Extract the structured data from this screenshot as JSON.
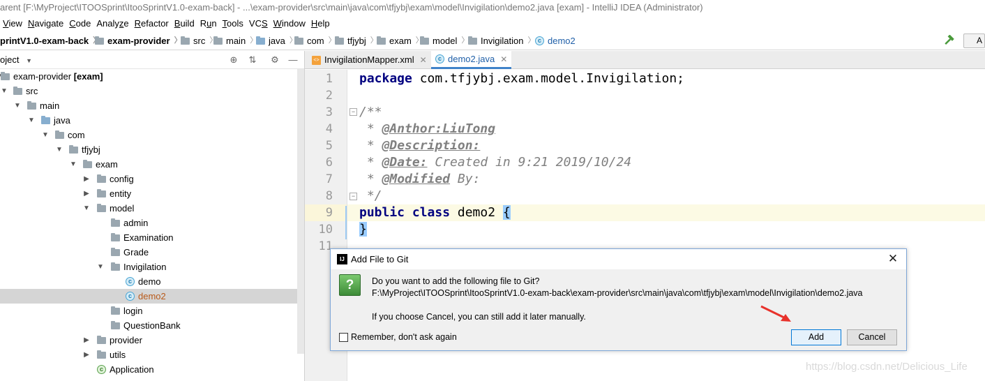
{
  "window": {
    "title": "arent [F:\\MyProject\\ITOOSprint\\ItooSprintV1.0-exam-back] - ...\\exam-provider\\src\\main\\java\\com\\tfjybj\\exam\\model\\Invigilation\\demo2.java [exam] - IntelliJ IDEA (Administrator)"
  },
  "menu": {
    "items": [
      {
        "label": "View",
        "mnemonic": "V"
      },
      {
        "label": "Navigate",
        "mnemonic": "N"
      },
      {
        "label": "Code",
        "mnemonic": "C"
      },
      {
        "label": "Analyze",
        "mnemonic": "z"
      },
      {
        "label": "Refactor",
        "mnemonic": "R"
      },
      {
        "label": "Build",
        "mnemonic": "B"
      },
      {
        "label": "Run",
        "mnemonic": "u"
      },
      {
        "label": "Tools",
        "mnemonic": "T"
      },
      {
        "label": "VCS",
        "mnemonic": "S"
      },
      {
        "label": "Window",
        "mnemonic": "W"
      },
      {
        "label": "Help",
        "mnemonic": "H"
      }
    ]
  },
  "breadcrumbs": [
    {
      "label": "printV1.0-exam-back",
      "icon": "none",
      "bold": true
    },
    {
      "label": "exam-provider",
      "icon": "module-folder-icon",
      "bold": true
    },
    {
      "label": "src",
      "icon": "folder-icon"
    },
    {
      "label": "main",
      "icon": "folder-icon"
    },
    {
      "label": "java",
      "icon": "source-folder-icon"
    },
    {
      "label": "com",
      "icon": "package-icon"
    },
    {
      "label": "tfjybj",
      "icon": "package-icon"
    },
    {
      "label": "exam",
      "icon": "package-icon"
    },
    {
      "label": "model",
      "icon": "package-icon"
    },
    {
      "label": "Invigilation",
      "icon": "package-icon"
    },
    {
      "label": "demo2",
      "icon": "class-icon"
    }
  ],
  "toolbar_right": {
    "label": "A"
  },
  "project_panel": {
    "title": "oject",
    "tree": [
      {
        "label": "exam-provider",
        "suffix": "[exam]",
        "arrow": "down",
        "icon": "module"
      },
      {
        "label": "src",
        "arrow": "down",
        "icon": "folder"
      },
      {
        "label": "main",
        "arrow": "down",
        "icon": "folder"
      },
      {
        "label": "java",
        "arrow": "down",
        "icon": "source"
      },
      {
        "label": "com",
        "arrow": "down",
        "icon": "package"
      },
      {
        "label": "tfjybj",
        "arrow": "down",
        "icon": "package"
      },
      {
        "label": "exam",
        "arrow": "down",
        "icon": "package"
      },
      {
        "label": "config",
        "arrow": "right",
        "icon": "package"
      },
      {
        "label": "entity",
        "arrow": "right",
        "icon": "package"
      },
      {
        "label": "model",
        "arrow": "down",
        "icon": "package"
      },
      {
        "label": "admin",
        "arrow": "none",
        "icon": "package"
      },
      {
        "label": "Examination",
        "arrow": "none",
        "icon": "package"
      },
      {
        "label": "Grade",
        "arrow": "none",
        "icon": "package"
      },
      {
        "label": "Invigilation",
        "arrow": "down",
        "icon": "package"
      },
      {
        "label": "demo",
        "arrow": "none",
        "icon": "class"
      },
      {
        "label": "demo2",
        "arrow": "none",
        "icon": "class",
        "selected": true
      },
      {
        "label": "login",
        "arrow": "none",
        "icon": "package"
      },
      {
        "label": "QuestionBank",
        "arrow": "none",
        "icon": "package"
      },
      {
        "label": "provider",
        "arrow": "right",
        "icon": "package"
      },
      {
        "label": "utils",
        "arrow": "right",
        "icon": "package"
      },
      {
        "label": "Application",
        "arrow": "none",
        "icon": "spring-class"
      }
    ]
  },
  "editor": {
    "tabs": [
      {
        "label": "InvigilationMapper.xml",
        "icon": "xml",
        "active": false
      },
      {
        "label": "demo2.java",
        "icon": "class",
        "active": true
      }
    ],
    "line_numbers": [
      "1",
      "2",
      "3",
      "4",
      "5",
      "6",
      "7",
      "8",
      "9",
      "10",
      "11"
    ],
    "lines": {
      "l1_kw": "package",
      "l1_rest": " com.tfjybj.exam.model.Invigilation;",
      "l3": "/**",
      "l4_pre": " * ",
      "l4_tag": "@Anthor:LiuTong",
      "l5_pre": " * ",
      "l5_tag": "@Description:",
      "l6_pre": " * ",
      "l6_tag": "@Date:",
      "l6_rest": " Created in 9:21 2019/10/24",
      "l7_pre": " * ",
      "l7_tag": "@Modified",
      "l7_rest": " By:",
      "l8": " */",
      "l9_kw": "public class",
      "l9_rest": " demo2 ",
      "l9_brace": "{",
      "l10_brace": "}"
    }
  },
  "dialog": {
    "title": "Add File to Git",
    "question": "Do you want to add the following file to Git?",
    "path": "F:\\MyProject\\ITOOSprint\\ItooSprintV1.0-exam-back\\exam-provider\\src\\main\\java\\com\\tfjybj\\exam\\model\\Invigilation\\demo2.java",
    "note": "If you choose Cancel, you can still add it later manually.",
    "remember_label": "Remember, don't ask again",
    "remember_checked": false,
    "add_label": "Add",
    "cancel_label": "Cancel"
  },
  "watermark": "https://blog.csdn.net/Delicious_Life",
  "colors": {
    "selection": "#d5d5d5",
    "keyword": "#000080",
    "comment": "#808080",
    "current_line": "#fcfae4",
    "brace_highlight": "#99ccff",
    "dialog_default_button": "#0078d7",
    "annotation_arrow": "#e8322b"
  }
}
